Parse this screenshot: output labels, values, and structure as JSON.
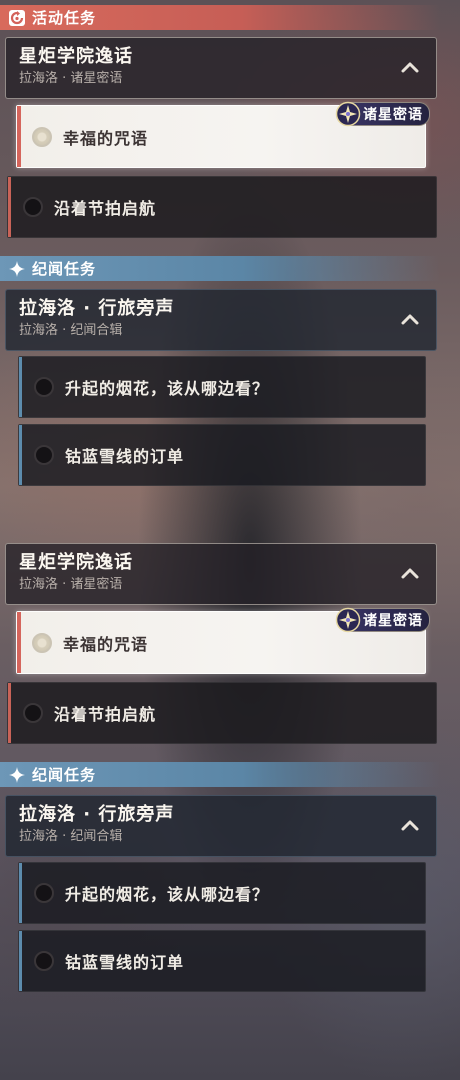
{
  "colors": {
    "activity_header": "#d86a5c",
    "chronicle_header": "#6d97b7",
    "selected_bar": "#d5655c",
    "chronicle_bar": "#5d8cad"
  },
  "panels": [
    {
      "activity_section": {
        "title": "活动任务",
        "icon": "activity-mission-icon"
      },
      "activity_group": {
        "title": "星炬学院逸话",
        "subtitle": "拉海洛 · 诸星密语",
        "collapse_icon": "chevron-up-icon"
      },
      "badge": {
        "icon": "star-compass-icon",
        "text": "诸星密语"
      },
      "activity_quests": [
        {
          "label": "幸福的咒语",
          "state": "selected"
        },
        {
          "label": "沿着节拍启航",
          "state": "idle"
        }
      ],
      "chronicle_section": {
        "title": "纪闻任务",
        "icon": "sparkle-star-icon"
      },
      "chronicle_group": {
        "title": "拉海洛 · 行旅旁声",
        "subtitle": "拉海洛 · 纪闻合辑",
        "collapse_icon": "chevron-up-icon"
      },
      "chronicle_quests": [
        {
          "label": "升起的烟花，该从哪边看？",
          "state": "idle"
        },
        {
          "label": "钴蓝雪线的订单",
          "state": "idle"
        }
      ]
    },
    {
      "activity_group": {
        "title": "星炬学院逸话",
        "subtitle": "拉海洛 · 诸星密语",
        "collapse_icon": "chevron-up-icon"
      },
      "badge": {
        "icon": "star-compass-icon",
        "text": "诸星密语"
      },
      "activity_quests": [
        {
          "label": "幸福的咒语",
          "state": "selected"
        },
        {
          "label": "沿着节拍启航",
          "state": "idle"
        }
      ],
      "chronicle_section": {
        "title": "纪闻任务",
        "icon": "sparkle-star-icon"
      },
      "chronicle_group": {
        "title": "拉海洛 · 行旅旁声",
        "subtitle": "拉海洛 · 纪闻合辑",
        "collapse_icon": "chevron-up-icon"
      },
      "chronicle_quests": [
        {
          "label": "升起的烟花，该从哪边看？",
          "state": "idle"
        },
        {
          "label": "钴蓝雪线的订单",
          "state": "idle"
        }
      ]
    }
  ]
}
